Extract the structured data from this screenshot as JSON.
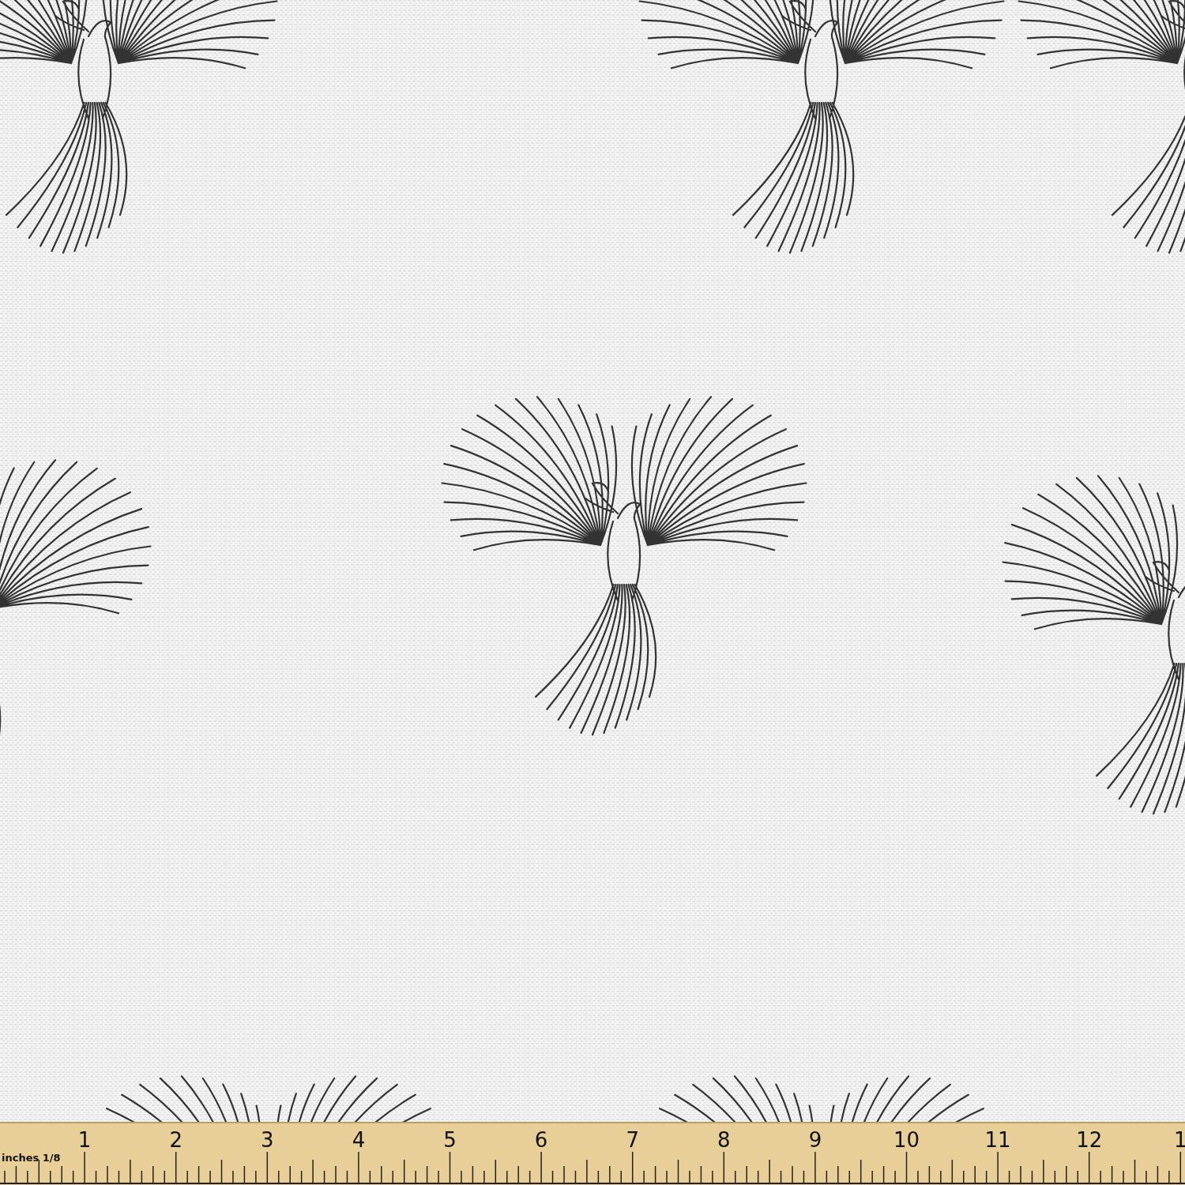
{
  "ruler": {
    "unit": "inches",
    "subdivision": "1/8",
    "numbers": [
      "1",
      "2",
      "3",
      "4",
      "5",
      "6",
      "7",
      "8",
      "9",
      "10",
      "11",
      "12",
      "1"
    ]
  }
}
